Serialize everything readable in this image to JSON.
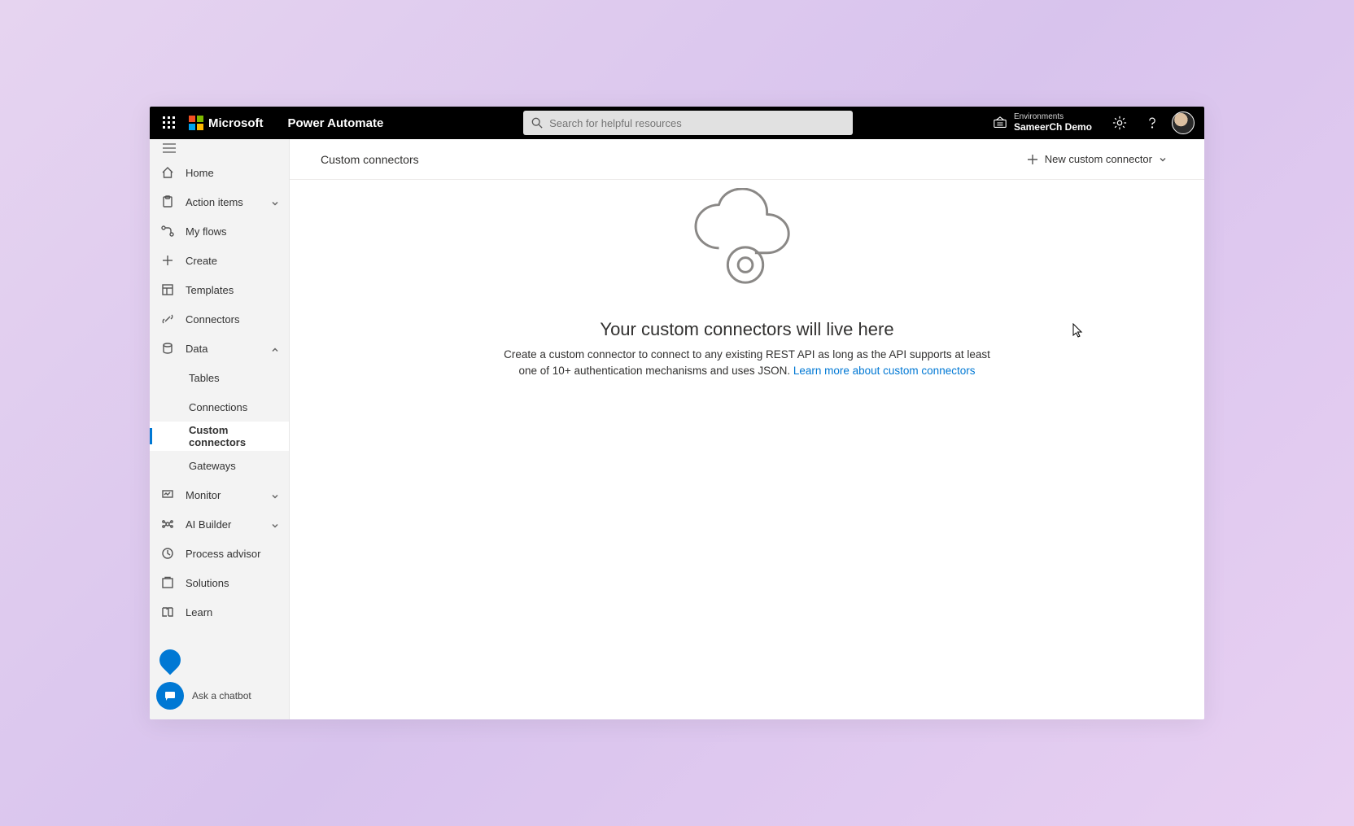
{
  "header": {
    "brand": "Microsoft",
    "app_name": "Power Automate",
    "search_placeholder": "Search for helpful resources",
    "env_label": "Environments",
    "env_value": "SameerCh Demo"
  },
  "sidebar": {
    "items": [
      {
        "label": "Home"
      },
      {
        "label": "Action items"
      },
      {
        "label": "My flows"
      },
      {
        "label": "Create"
      },
      {
        "label": "Templates"
      },
      {
        "label": "Connectors"
      },
      {
        "label": "Data"
      },
      {
        "label": "Tables"
      },
      {
        "label": "Connections"
      },
      {
        "label": "Custom connectors"
      },
      {
        "label": "Gateways"
      },
      {
        "label": "Monitor"
      },
      {
        "label": "AI Builder"
      },
      {
        "label": "Process advisor"
      },
      {
        "label": "Solutions"
      },
      {
        "label": "Learn"
      }
    ],
    "chatbot_label": "Ask a chatbot"
  },
  "cmdbar": {
    "title": "Custom connectors",
    "new_label": "New custom connector"
  },
  "empty": {
    "heading": "Your custom connectors will live here",
    "body": "Create a custom connector to connect to any existing REST API as long as the API supports at least one of 10+ authentication mechanisms and uses JSON. ",
    "link": "Learn more about custom connectors"
  }
}
